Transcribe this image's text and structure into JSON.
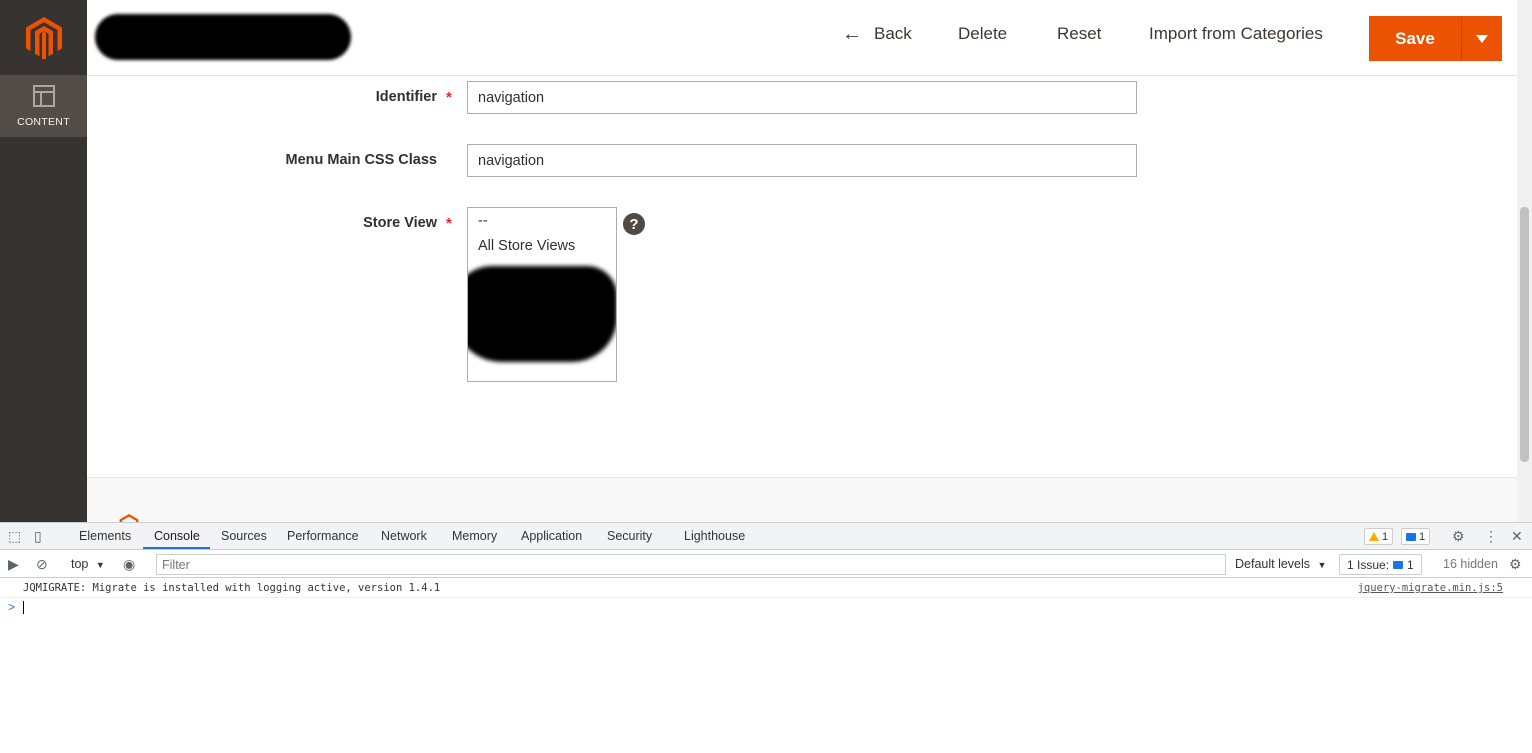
{
  "sidebar": {
    "items": [
      {
        "label": "CONTENT",
        "icon": "content-layout-icon"
      }
    ]
  },
  "header": {
    "back_label": "Back",
    "delete_label": "Delete",
    "reset_label": "Reset",
    "import_label": "Import from Categories",
    "save_label": "Save"
  },
  "form": {
    "identifier": {
      "label": "Identifier",
      "value": "navigation",
      "required": true
    },
    "css_class": {
      "label": "Menu Main CSS Class",
      "value": "navigation"
    },
    "store_view": {
      "label": "Store View",
      "required": true,
      "options": [
        "--",
        "All Store Views"
      ],
      "help": "?"
    }
  },
  "devtools": {
    "tabs": [
      "Elements",
      "Console",
      "Sources",
      "Performance",
      "Network",
      "Memory",
      "Application",
      "Security",
      "Lighthouse"
    ],
    "active_tab": "Console",
    "warning_count": "1",
    "message_count": "1",
    "context": "top",
    "filter_placeholder": "Filter",
    "levels": "Default levels",
    "issues_label": "1 Issue:",
    "issues_count": "1",
    "hidden": "16 hidden",
    "console": {
      "message": "JQMIGRATE: Migrate is installed with logging active, version 1.4.1",
      "source": "jquery-migrate.min.js:5",
      "prompt": ">"
    }
  },
  "colors": {
    "accent": "#eb5202",
    "sidebar": "#373330",
    "devtools_link": "#1a73e8"
  }
}
